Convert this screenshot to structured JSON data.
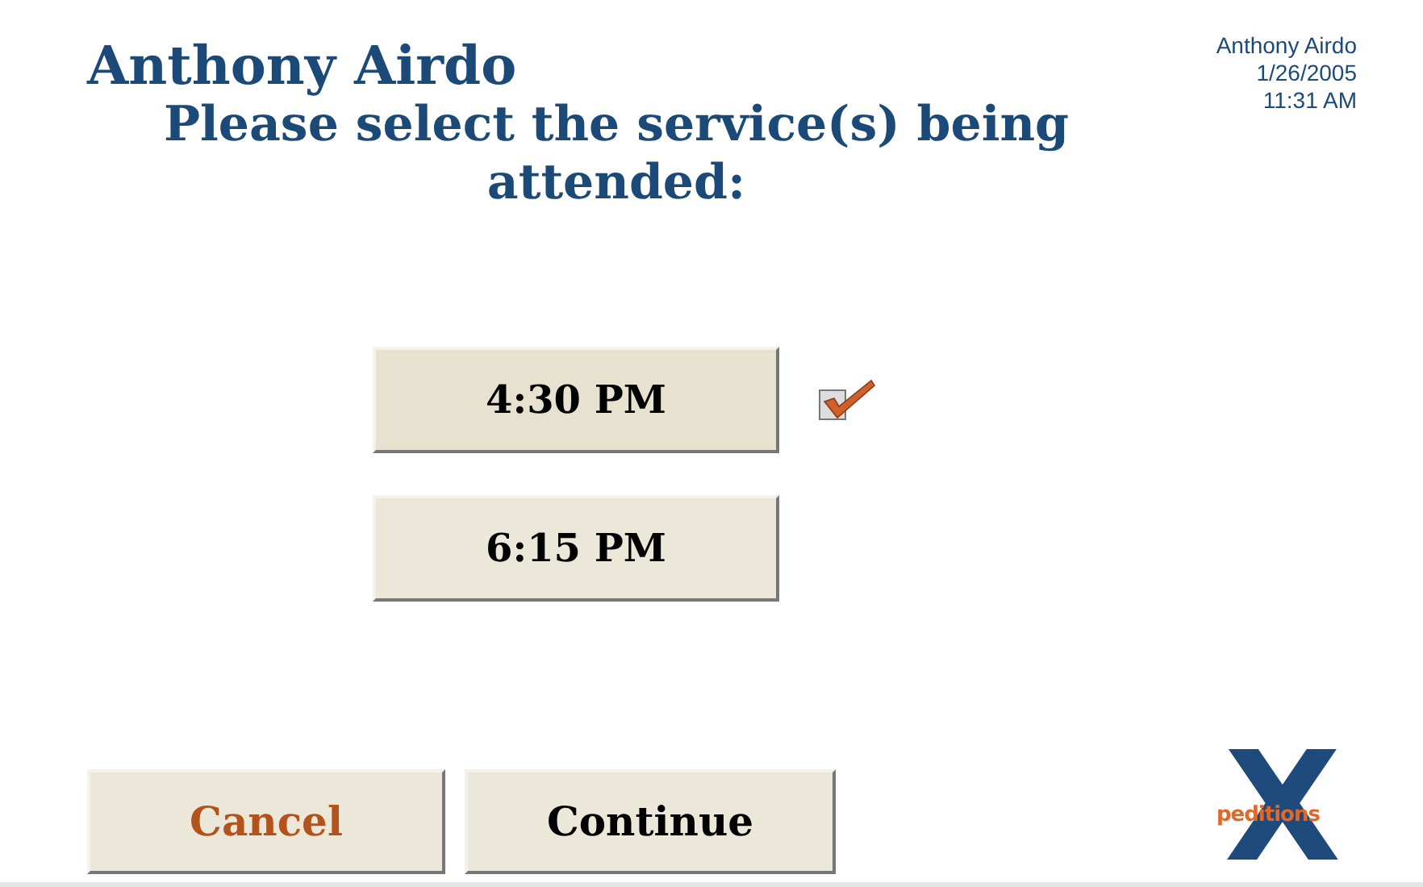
{
  "header": {
    "title": "Anthony Airdo",
    "user": "Anthony Airdo",
    "date": "1/26/2005",
    "time": "11:31 AM"
  },
  "prompt": "Please select the service(s) being attended:",
  "services": [
    {
      "label": "4:30 PM",
      "selected": true
    },
    {
      "label": "6:15 PM",
      "selected": false
    }
  ],
  "buttons": [
    {
      "label": "Cancel",
      "kind": "cancel"
    },
    {
      "label": "Continue",
      "kind": "continue"
    }
  ],
  "logo": {
    "letter": "X",
    "word": "peditions"
  }
}
